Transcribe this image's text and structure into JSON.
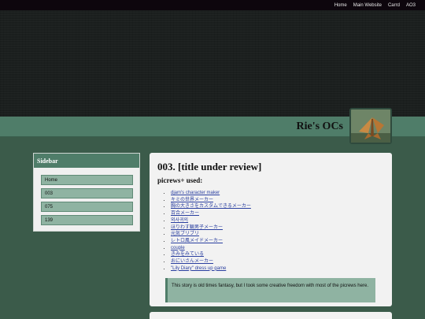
{
  "topnav": [
    "Home",
    "Main Website",
    "Carrd",
    "AO3"
  ],
  "site": {
    "title": "Rie's OCs"
  },
  "sidebar": {
    "heading": "Sidebar",
    "items": [
      "Home",
      "003",
      "075",
      "139"
    ]
  },
  "main": {
    "title": "003. [title under review]",
    "subtitle": "picrews+ used:",
    "picrews": [
      "djam's character maker",
      "キミの世界メーカー",
      "胸の大きさをカスタムできるメーカー",
      "百合メーカー",
      "외사귀의",
      "ほりわす観男子メーカー",
      "元気ブリブリ",
      "レトロ風メイドメーカー",
      "couple",
      "きみをみている",
      "おにいさんメーカー",
      "\"Lily Diary\" dress up game"
    ],
    "note": "This story is old times fantasy, but I took some creative freedom with most of the picrews here."
  },
  "colors": {
    "page_bg": "#3b5b4a",
    "accent": "#4f7d69",
    "sidebar_item": "#8fb3a2",
    "topbar": "#0d060d"
  }
}
